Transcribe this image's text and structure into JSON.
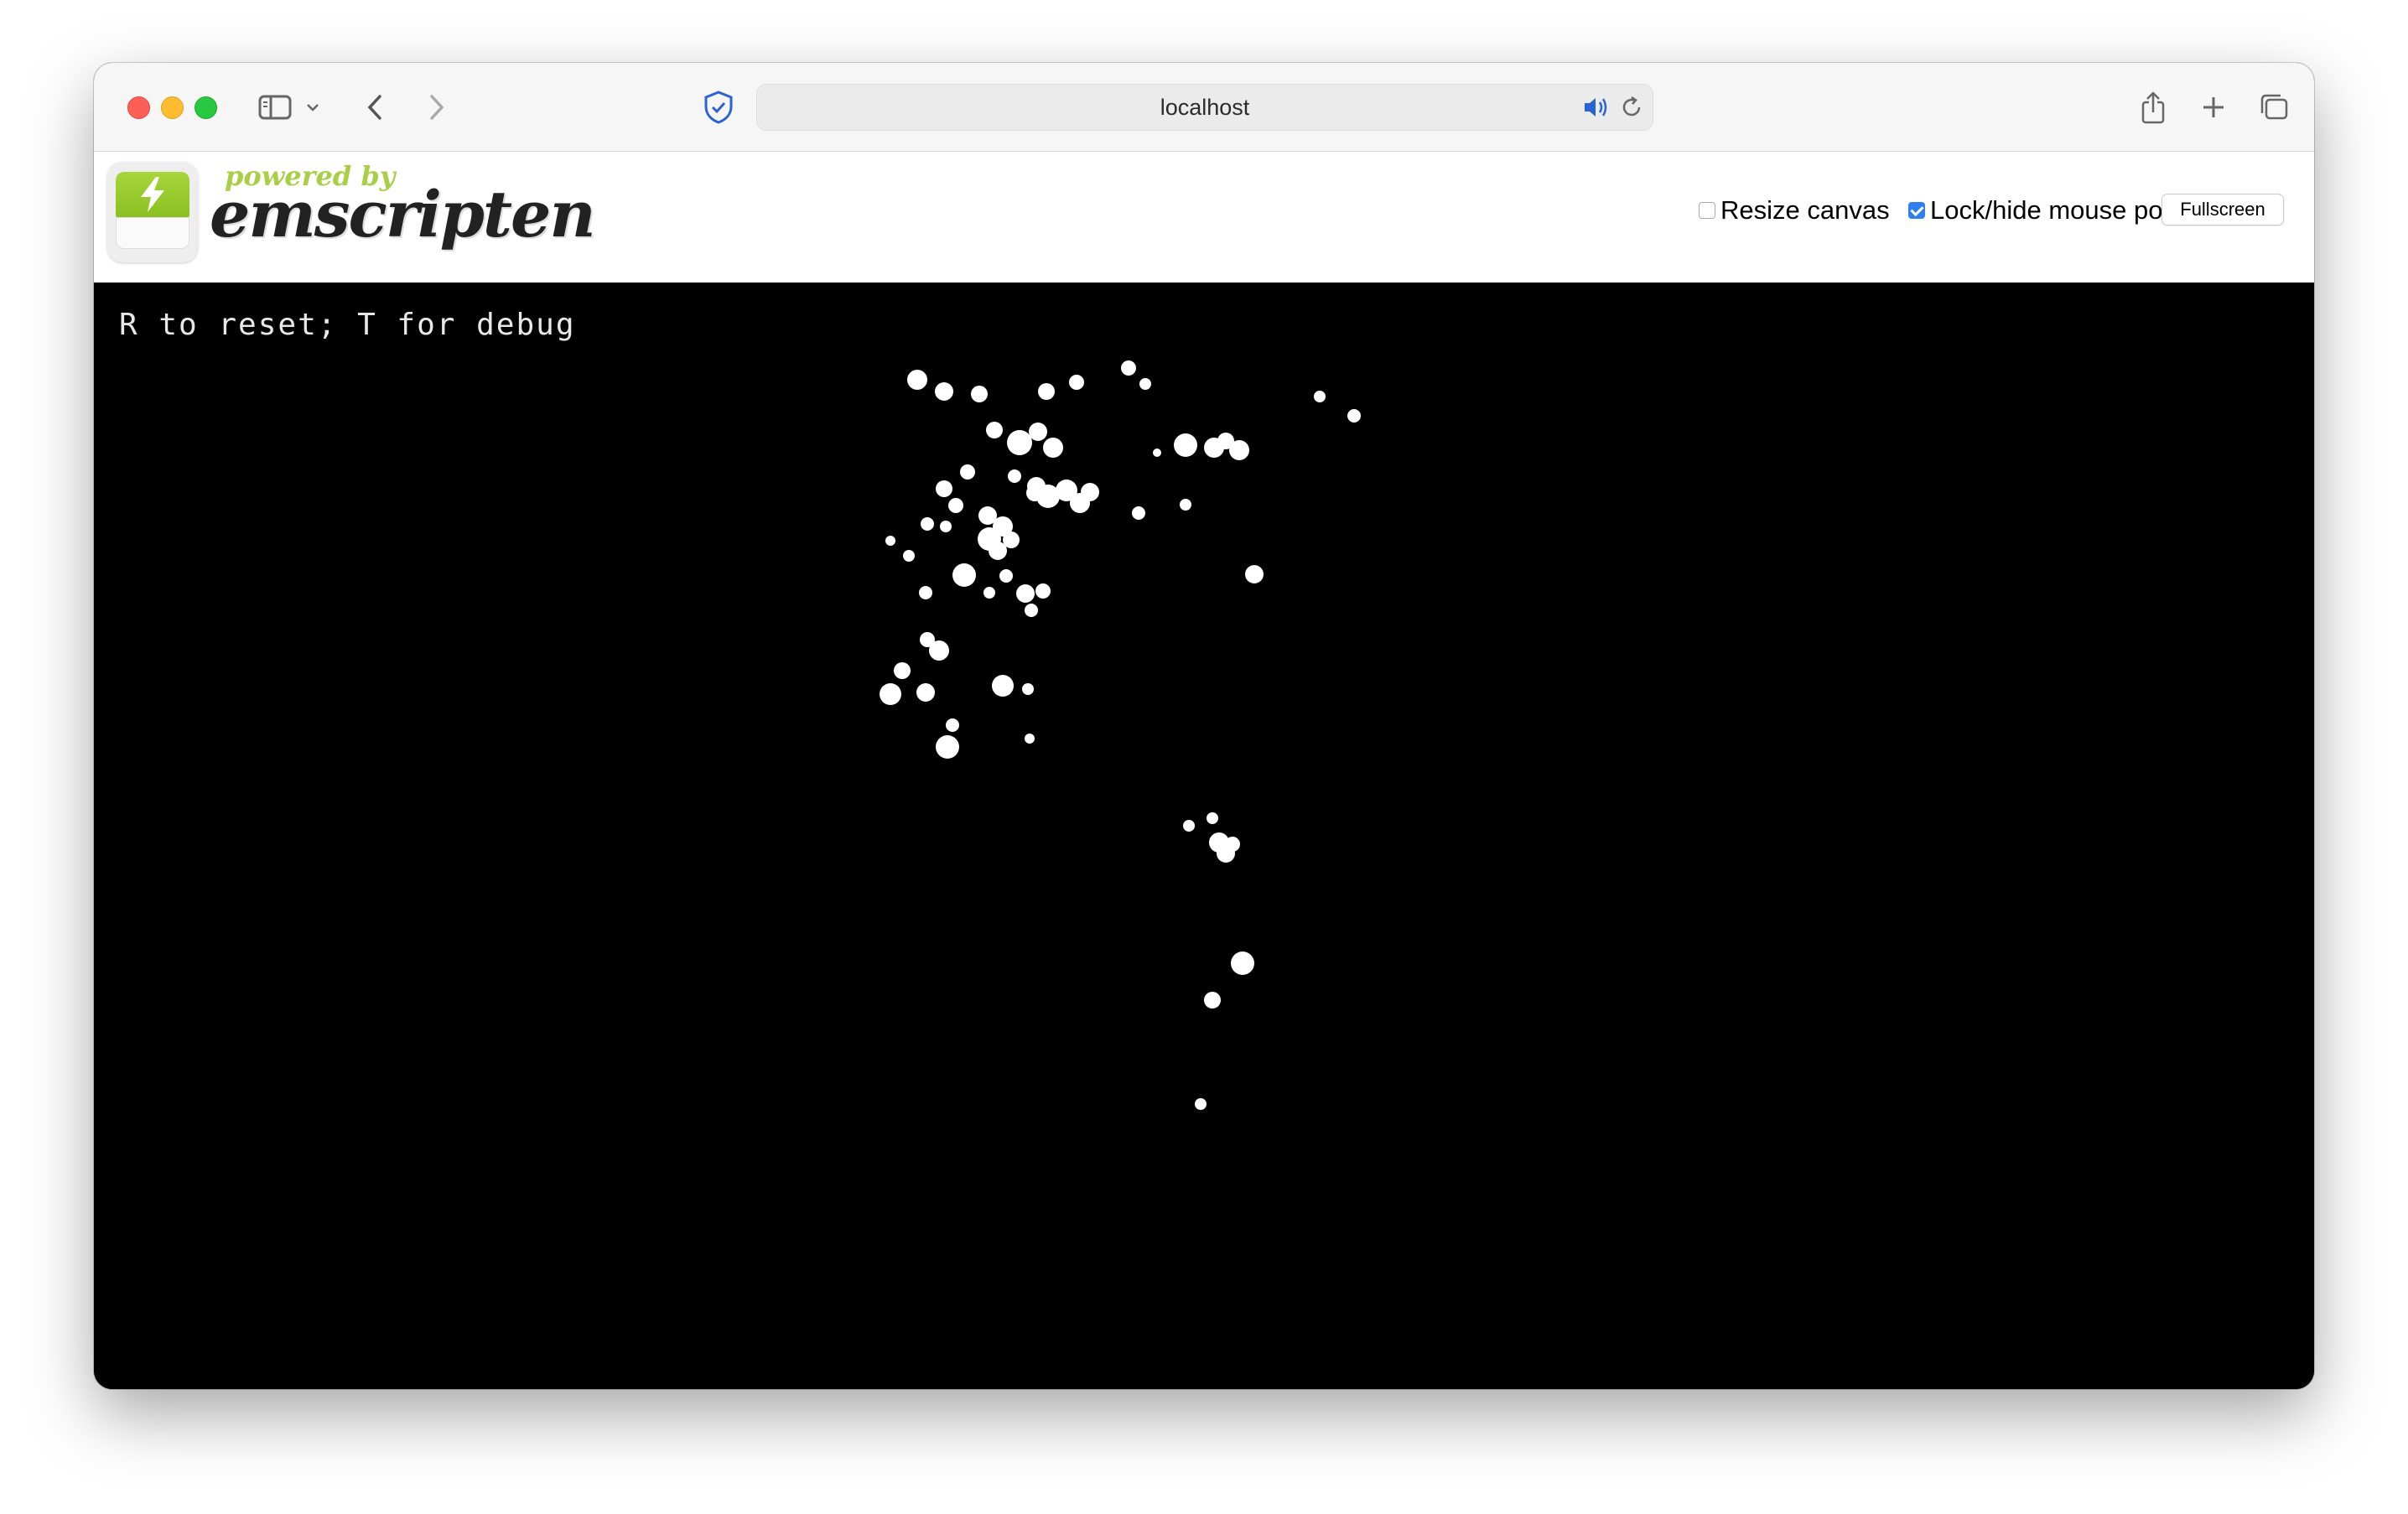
{
  "browser": {
    "url": "localhost"
  },
  "header": {
    "logo_powered": "powered by",
    "logo_name": "emscripten",
    "resize_canvas": {
      "label": "Resize canvas",
      "checked": false
    },
    "lock_pointer": {
      "label": "Lock/hide mouse pointer",
      "checked": true
    },
    "fullscreen_label": "Fullscreen"
  },
  "canvas": {
    "hint_text": "R to reset; T for debug",
    "background": "#000000",
    "ball_color": "#ffffff"
  }
}
